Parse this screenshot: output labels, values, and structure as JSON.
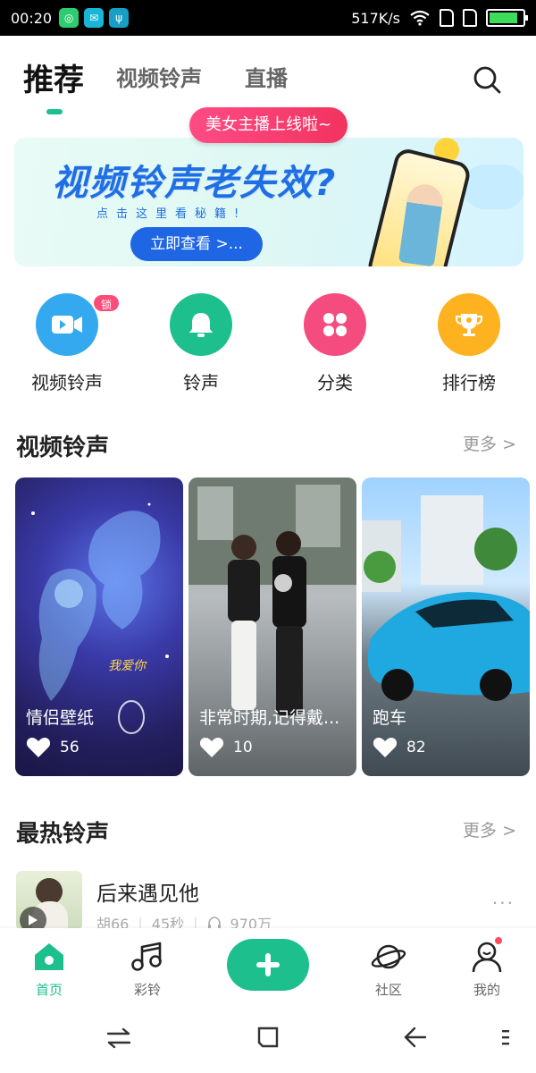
{
  "status_bar": {
    "time": "00:20",
    "speed": "517K/s"
  },
  "top_tabs": {
    "tab1": "推荐",
    "tab2": "视频铃声",
    "tab3": "直播"
  },
  "banner": {
    "tooltip": "美女主播上线啦~",
    "title": "视频铃声老失效?",
    "subtitle": "点击这里看秘籍!",
    "button": "立即查看 >..."
  },
  "quick_links": {
    "video_ringtone": "视频铃声",
    "video_badge": "锁屏壁纸",
    "ringtone": "铃声",
    "category": "分类",
    "ranking": "排行榜"
  },
  "video_section": {
    "title": "视频铃声",
    "more": "更多 >",
    "cards": [
      {
        "title": "情侣壁纸",
        "likes": "56",
        "overlay_text": "我爱你"
      },
      {
        "title": "非常时期,记得戴...",
        "likes": "10"
      },
      {
        "title": "跑车",
        "likes": "82"
      }
    ]
  },
  "hot_section": {
    "title": "最热铃声",
    "more": "更多 >",
    "songs": [
      {
        "title": "后来遇见他",
        "artist": "胡66",
        "duration": "45秒",
        "plays": "970万"
      }
    ]
  },
  "bottom_nav": {
    "home": "首页",
    "ringtone": "彩铃",
    "community": "社区",
    "mine": "我的"
  },
  "colors": {
    "accent": "#1dc08c",
    "blue": "#1f66e5",
    "pink": "#ff4b7a",
    "orange": "#ffb21f"
  }
}
